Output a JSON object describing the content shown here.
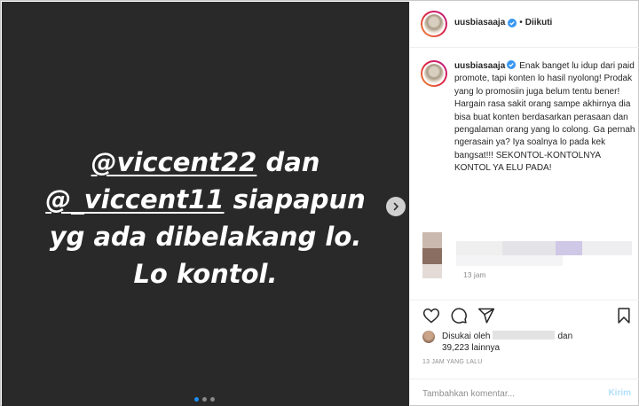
{
  "media": {
    "story_lines": [
      {
        "mention": "@viccent22",
        "rest": " dan"
      },
      {
        "mention": "@_viccent11",
        "rest": " siapapun"
      },
      {
        "mention": "",
        "rest": "yg ada dibelakang lo."
      },
      {
        "mention": "",
        "rest": "Lo kontol."
      }
    ],
    "carousel_count": 3,
    "carousel_active": 1
  },
  "header": {
    "username": "uusbiasaaja",
    "separator": "•",
    "follow_status": "Diikuti"
  },
  "caption": {
    "username": "uusbiasaaja",
    "text": "Enak banget lu idup dari paid promote, tapi konten lo hasil nyolong! Prodak yang lo promosiin juga belum tentu bener! Hargain rasa sakit orang sampe akhirnya dia bisa buat konten berdasarkan perasaan dan pengalaman orang yang lo colong. Ga pernah ngerasain ya? Iya soalnya lo pada kek bangsat!!! SEKONTOL-KONTOLNYA KONTOL YA ELU PADA!",
    "time": "13 jam"
  },
  "likes": {
    "prefix": "Disukai oleh",
    "suffix": "dan",
    "count": "39,223 lainnya"
  },
  "post_time": "13 JAM YANG LALU",
  "add_comment": {
    "placeholder": "Tambahkan komentar...",
    "send_label": "Kirim"
  },
  "colors": {
    "media_bg": "#292929",
    "verified": "#3897f0",
    "send_disabled": "#b2dffc",
    "dot_active": "#1e8cf0"
  },
  "icons": [
    "chevron-right-icon",
    "verified-badge-icon",
    "heart-icon",
    "comment-icon",
    "share-icon",
    "bookmark-icon"
  ]
}
